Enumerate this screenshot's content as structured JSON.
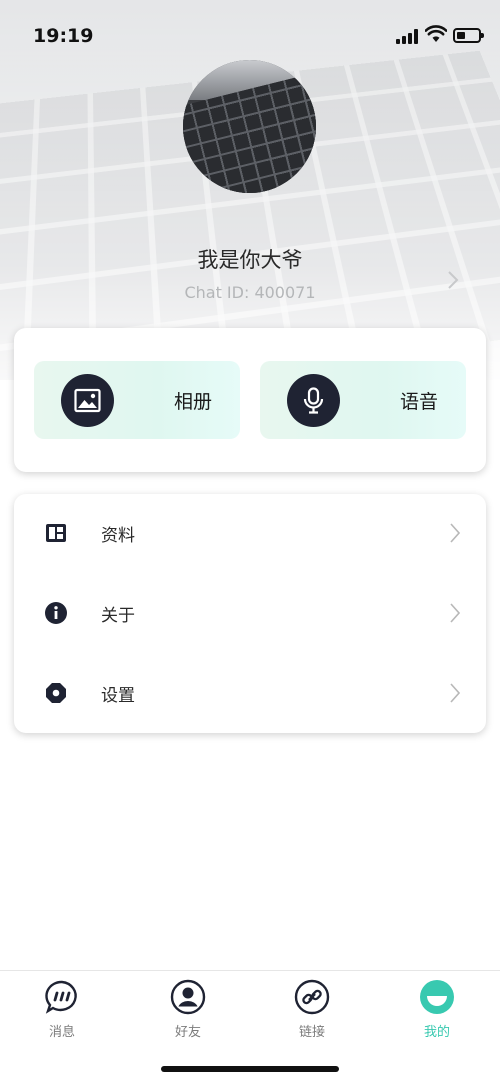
{
  "status_bar": {
    "time": "19:19"
  },
  "profile": {
    "name": "我是你大爷",
    "chat_id": "Chat ID: 400071"
  },
  "quick_actions": [
    {
      "label": "相册",
      "icon": "image-icon"
    },
    {
      "label": "语音",
      "icon": "microphone-icon"
    }
  ],
  "menu": [
    {
      "label": "资料",
      "icon": "profile-card-icon"
    },
    {
      "label": "关于",
      "icon": "info-icon"
    },
    {
      "label": "设置",
      "icon": "settings-icon"
    }
  ],
  "tabbar": {
    "tabs": [
      {
        "label": "消息",
        "icon": "chat-bubble-icon",
        "active": false
      },
      {
        "label": "好友",
        "icon": "user-icon",
        "active": false
      },
      {
        "label": "链接",
        "icon": "link-icon",
        "active": false
      },
      {
        "label": "我的",
        "icon": "smile-icon",
        "active": true
      }
    ]
  },
  "colors": {
    "accent": "#38c9b0",
    "icon_dark": "#1f2333",
    "action_bg": "#e3f7f1"
  }
}
